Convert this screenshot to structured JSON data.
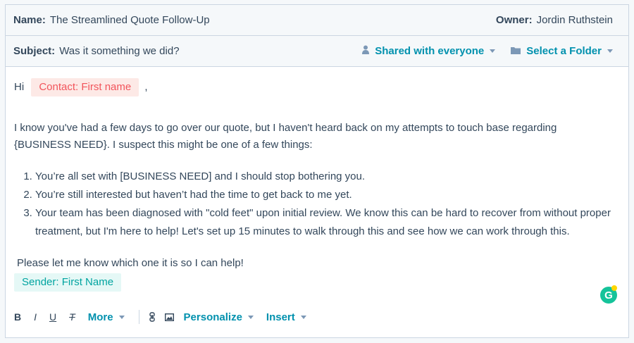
{
  "template": {
    "name_label": "Name:",
    "name_value": "The Streamlined Quote Follow-Up",
    "owner_label": "Owner:",
    "owner_value": "Jordin Ruthstein",
    "subject_label": "Subject:",
    "subject_value": "Was it something we did?",
    "shared_label": "Shared with everyone",
    "folder_label": "Select a Folder"
  },
  "email": {
    "greeting": "Hi",
    "contact_token": "Contact: First name",
    "comma": ",",
    "para1_line1": "I know you've had a few days to go over our quote, but I haven't heard back on my attempts to touch base regarding",
    "para1_line2": "{BUSINESS NEED}. I suspect this might be one of a few things:",
    "list": [
      "You’re all set with [BUSINESS NEED] and I should stop bothering you.",
      "You’re still interested but haven’t had the time to get back to me yet.",
      "Your team has been diagnosed with \"cold feet\" upon initial review. We know this can be hard to recover from without proper treatment, but I'm here to help! Let's set up 15 minutes to walk through this and see how we can work through this."
    ],
    "closing": "Please let me know which one it is so I can help!",
    "sender_token": "Sender: First Name"
  },
  "toolbar": {
    "bold": "B",
    "italic": "I",
    "underline": "U",
    "clear_format": "T",
    "more": "More",
    "personalize": "Personalize",
    "insert": "Insert"
  },
  "grammarly": {
    "letter": "G"
  },
  "colors": {
    "link": "#0091ae",
    "contact_token_bg": "#fde9e6",
    "contact_token_text": "#f2545b",
    "sender_token_bg": "#e5f8f6",
    "sender_token_text": "#00a4a0",
    "border": "#cbd6e2"
  },
  "icons": {
    "shared": "person-icon",
    "folder": "folder-icon",
    "link": "link-icon",
    "image": "image-icon",
    "grammarly": "grammarly-icon"
  }
}
